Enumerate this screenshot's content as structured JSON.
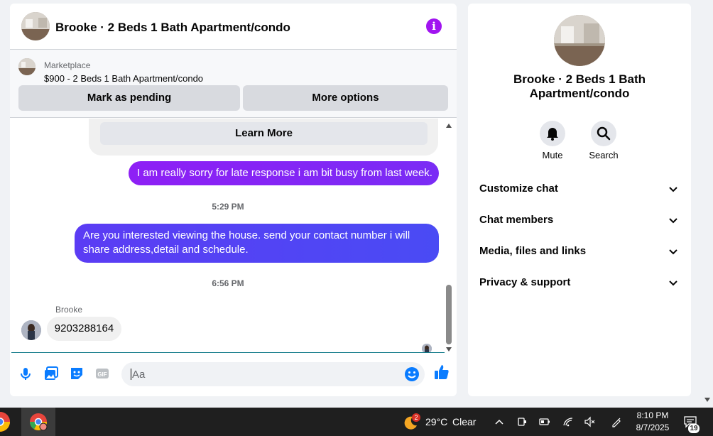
{
  "conversation": {
    "title": "Brooke · 2 Beds 1 Bath Apartment/condo"
  },
  "marketplace": {
    "label": "Marketplace",
    "listing": "$900 - 2 Beds 1 Bath Apartment/condo",
    "mark_pending": "Mark as pending",
    "more_options": "More options"
  },
  "messages": {
    "learn_more": "Learn More",
    "outgoing_1": "I am really sorry for late response i am bit busy from last week.",
    "time_1": "5:29 PM",
    "outgoing_2": "Are you interested viewing the house. send your contact number i will share address,detail and schedule.",
    "time_2": "6:56 PM",
    "sender": "Brooke",
    "incoming_1": "9203288164"
  },
  "composer": {
    "placeholder": "Aa",
    "icons": [
      "microphone-icon",
      "image-icon",
      "sticker-icon",
      "gif-icon",
      "emoji-icon",
      "thumbs-up-icon"
    ]
  },
  "info_panel": {
    "title": "Brooke · 2 Beds 1 Bath Apartment/condo",
    "mute": "Mute",
    "search": "Search",
    "sections": [
      "Customize chat",
      "Chat members",
      "Media, files and links",
      "Privacy & support"
    ]
  },
  "taskbar": {
    "weather_badge": "2",
    "temperature": "29°C",
    "condition": "Clear",
    "time": "8:10 PM",
    "date": "8/7/2025",
    "notification_count": "19"
  },
  "colors": {
    "accent": "#a114f0",
    "bubble_purple": "#8e1ff5",
    "bubble_blue": "#4a4bf4",
    "icon_blue": "#0a7cff"
  }
}
